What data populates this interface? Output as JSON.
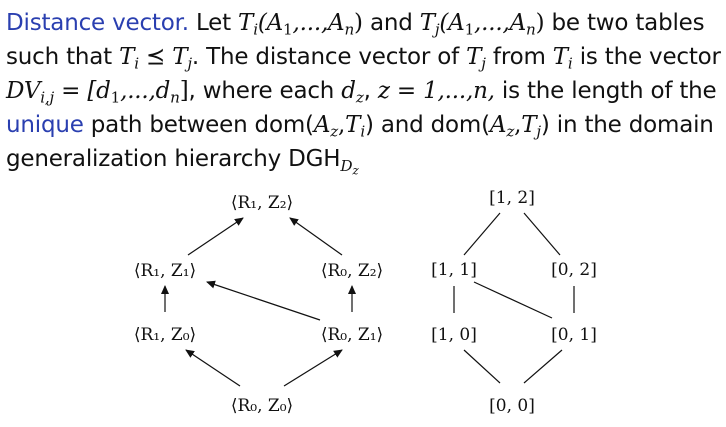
{
  "definition": {
    "term": "Distance vector.",
    "line1": {
      "a": " Let ",
      "Ti": "T",
      "Ti_sub": "i",
      "args": "(A",
      "args_sub1": "1",
      "args_mid": ",...,A",
      "args_subn": "n",
      "args_end": ")",
      "b": " and ",
      "Tj": "T",
      "Tj_sub": "j",
      "args2": "(A",
      "args2_sub1": "1",
      "args2_mid": ",...,A",
      "args2_subn": "n",
      "args2_end": ")",
      "c": " be two tables"
    },
    "line2": {
      "a": "such that ",
      "Ti": "T",
      "Ti_sub": "i",
      "prec": " ⪯ ",
      "Tj": "T",
      "Tj_sub": "j",
      "b": ". The distance vector of ",
      "Tj2": "T",
      "Tj2_sub": "j",
      "c": " from ",
      "Ti2": "T",
      "Ti2_sub": "i",
      "d": " is the vector"
    },
    "line3": {
      "dv": "DV",
      "dv_sub": "i,j",
      "eq": " = [d",
      "d1_sub": "1",
      "dots": ",...,d",
      "dn_sub": "n",
      "close": "]",
      "a": ", where each ",
      "dz": "d",
      "dz_sub": "z",
      "b": ", ",
      "z": "z",
      "range": " = 1,...,n,",
      "c": " is the length of the"
    },
    "line4": {
      "unique": "unique",
      "a": " path between dom(",
      "Az": "A",
      "Az_sub": "z",
      "b": ",",
      "Ti": "T",
      "Ti_sub": "i",
      "c": ") and dom(",
      "Az2": "A",
      "Az2_sub": "z",
      "d": ",",
      "Tj": "T",
      "Tj_sub": "j",
      "e": ") in the domain"
    },
    "line5": {
      "a": "generalization hierarchy DGH",
      "sub": "D",
      "subsub": "z"
    }
  },
  "lattice_left": {
    "top": "⟨R₁, Z₂⟩",
    "mid_left": "⟨R₁, Z₁⟩",
    "mid_right": "⟨R₀, Z₂⟩",
    "low_left": "⟨R₁, Z₀⟩",
    "low_right": "⟨R₀, Z₁⟩",
    "bottom": "⟨R₀, Z₀⟩"
  },
  "lattice_right": {
    "top": "[1, 2]",
    "mid_left": "[1, 1]",
    "mid_right": "[0, 2]",
    "low_left": "[1, 0]",
    "low_right": "[0, 1]",
    "bottom": "[0, 0]"
  }
}
